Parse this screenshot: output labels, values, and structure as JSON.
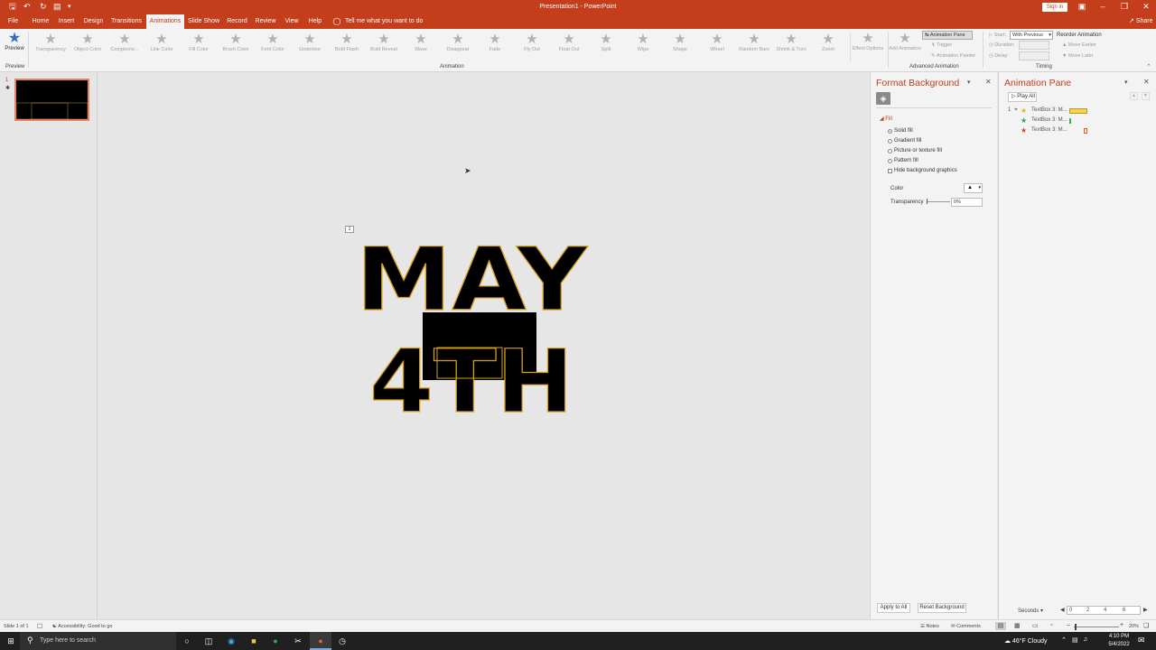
{
  "title_bar": {
    "title": "Presentation1 - PowerPoint",
    "sign_in": "Sign in"
  },
  "tabs": [
    "File",
    "Home",
    "Insert",
    "Design",
    "Transitions",
    "Animations",
    "Slide Show",
    "Record",
    "Review",
    "View",
    "Help"
  ],
  "active_tab": "Animations",
  "tell_me": "Tell me what you want to do",
  "share": "Share",
  "ribbon": {
    "preview": {
      "label": "Preview",
      "group": "Preview"
    },
    "animations": [
      "Transparency",
      "Object Color",
      "Compleme...",
      "Line Color",
      "Fill Color",
      "Brush Color",
      "Font Color",
      "Underline",
      "Bold Flash",
      "Bold Reveal",
      "Wave",
      "Disappear",
      "Fade",
      "Fly Out",
      "Float Out",
      "Split",
      "Wipe",
      "Shape",
      "Wheel",
      "Random Bars",
      "Shrink & Turn",
      "Zoom"
    ],
    "effect_options": "Effect Options",
    "animation_group": "Animation",
    "add_animation": "Add Animation",
    "animation_pane": "Animation Pane",
    "trigger": "Trigger",
    "animation_painter": "Animation Painter",
    "advanced_group": "Advanced Animation",
    "start_label": "Start:",
    "start_value": "With Previous",
    "duration_label": "Duration:",
    "delay_label": "Delay:",
    "reorder": "Reorder Animation",
    "move_earlier": "Move Earlier",
    "move_later": "Move Later",
    "timing_group": "Timing"
  },
  "thumbnails": [
    {
      "number": "1"
    }
  ],
  "slide": {
    "line1": "MAY",
    "line2": "4TH",
    "tag": "1"
  },
  "format_background": {
    "title": "Format Background",
    "section": "Fill",
    "options": [
      "Solid fill",
      "Gradient fill",
      "Picture or texture fill",
      "Pattern fill"
    ],
    "selected": "Solid fill",
    "hide_graphics": "Hide background graphics",
    "color_label": "Color",
    "transparency_label": "Transparency",
    "transparency_value": "0%",
    "apply_all": "Apply to All",
    "reset": "Reset Background"
  },
  "animation_pane": {
    "title": "Animation Pane",
    "play_all": "Play All",
    "items": [
      {
        "number": "1",
        "label": "TextBox 3: M...",
        "star_color": "#e3b23c",
        "bar_color": "#f7d54a"
      },
      {
        "number": "",
        "label": "TextBox 3: M...",
        "star_color": "#2e9b6b",
        "bar_color": "#3fae49"
      },
      {
        "number": "",
        "label": "TextBox 3: M...",
        "star_color": "#d9412b",
        "bar_color": "#e8552e"
      }
    ],
    "seconds": "Seconds",
    "ticks": [
      "0",
      "2",
      "4",
      "6"
    ]
  },
  "status": {
    "slide": "Slide 1 of 1",
    "accessibility": "Accessibility: Good to go",
    "notes": "Notes",
    "comments": "Comments",
    "zoom": "20%"
  },
  "taskbar": {
    "search": "Type here to search",
    "weather": "46°F Cloudy",
    "time": "4:10 PM",
    "date": "5/4/2022"
  }
}
